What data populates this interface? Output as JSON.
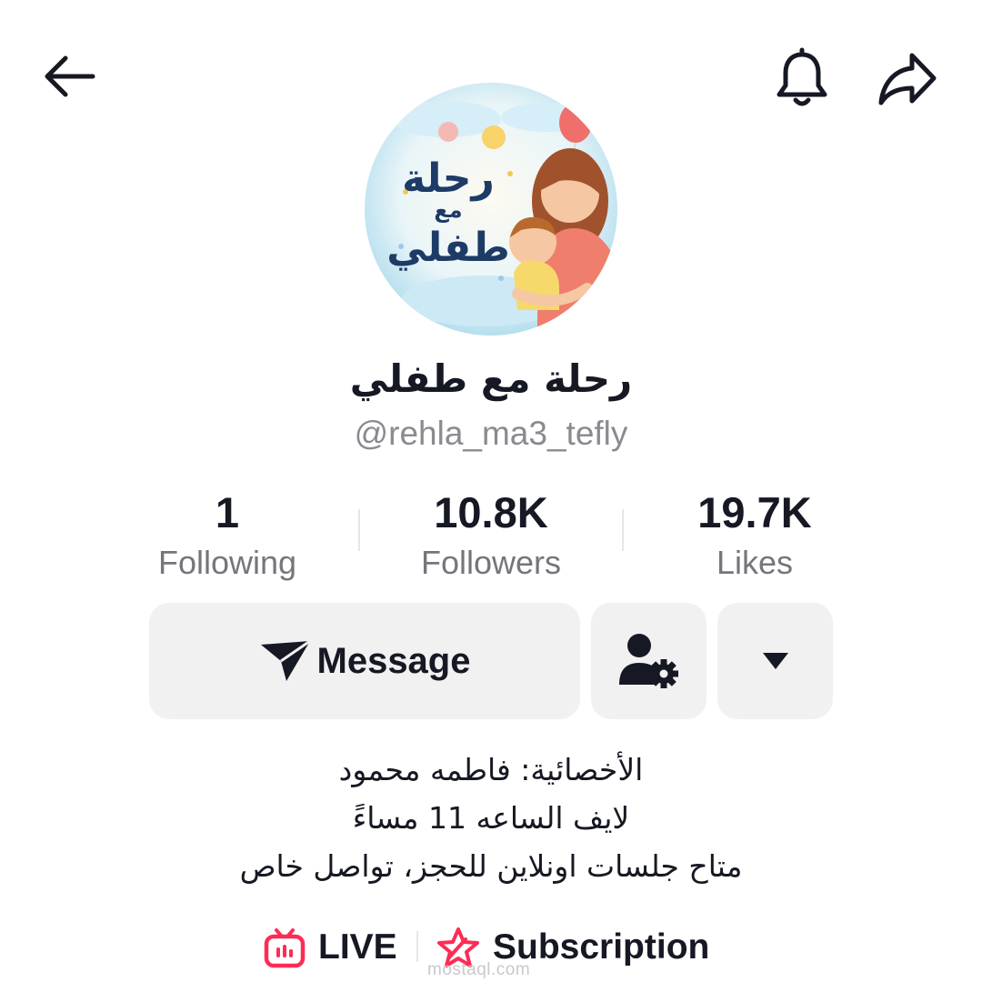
{
  "profile": {
    "display_name": "رحلة مع طفلي",
    "username": "@rehla_ma3_tefly",
    "avatar_text": [
      "رحلة",
      "مع",
      "طفلي"
    ]
  },
  "stats": [
    {
      "value": "1",
      "label": "Following"
    },
    {
      "value": "10.8K",
      "label": "Followers"
    },
    {
      "value": "19.7K",
      "label": "Likes"
    }
  ],
  "actions": {
    "message_label": "Message"
  },
  "bio": [
    "الأخصائية: فاطمه محمود",
    "لايف الساعه 11 مساءً",
    "متاح جلسات اونلاين للحجز، تواصل خاص"
  ],
  "links": {
    "live_label": "LIVE",
    "subscription_label": "Subscription"
  },
  "watermark": "mostaql.com",
  "colors": {
    "accent": "#fe2c55",
    "text": "#161823",
    "muted": "#75767c",
    "button_bg": "#f1f1f2"
  },
  "icons": {
    "back": "arrow-left-icon",
    "notifications": "bell-icon",
    "share": "share-arrow-icon",
    "message": "paper-plane-icon",
    "friend_settings": "user-gear-icon",
    "more": "caret-down-icon",
    "live": "tv-icon",
    "subscription": "star-badge-icon"
  }
}
